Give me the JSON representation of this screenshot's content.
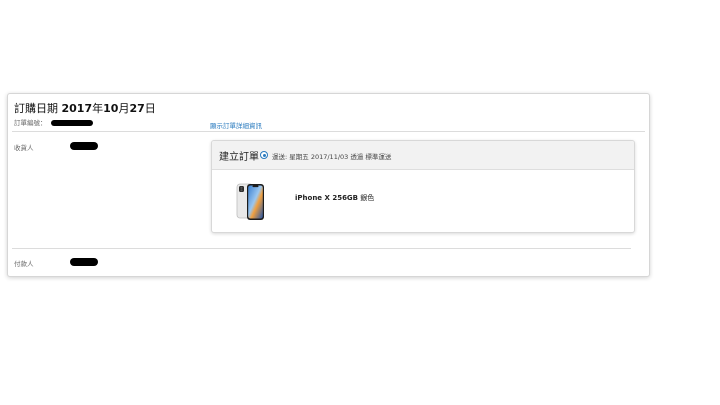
{
  "order": {
    "date_prefix": "訂購日期 ",
    "date_year": "2017",
    "date_year_unit": "年",
    "date_month": "10",
    "date_month_unit": "月",
    "date_day": "27",
    "date_day_unit": "日",
    "order_no_label": "訂單編號：",
    "details_link": "顯示訂單詳細資訊",
    "recipient_label": "收貨人",
    "payer_label": "付款人"
  },
  "shipment": {
    "status": "建立訂單",
    "info": "運送: 星期五 2017/11/03 透過 標準運送"
  },
  "product": {
    "name_en": "iPhone X 256GB",
    "name_color": " 銀色",
    "image_icon": "iphone-x-icon"
  },
  "colors": {
    "accent": "#2a7bbf",
    "header_bg": "#f2f2f2",
    "border": "#d6d6d6"
  }
}
